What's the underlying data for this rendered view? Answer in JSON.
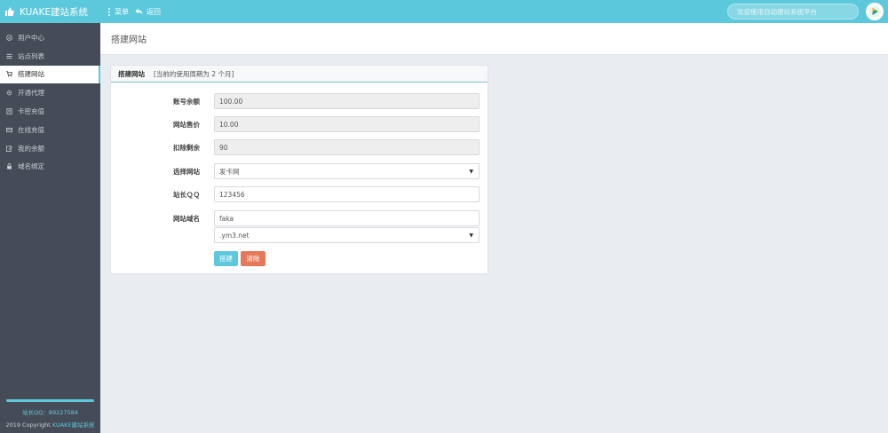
{
  "app": {
    "brand": "KUAKE建站系统",
    "menu_label": "菜单",
    "back_label": "返回",
    "search_placeholder": "欢迎使用自动建站系统平台"
  },
  "sidebar": {
    "items": [
      {
        "label": "用户中心",
        "icon": "circle-check-icon"
      },
      {
        "label": "站点列表",
        "icon": "list-icon"
      },
      {
        "label": "搭建网站",
        "icon": "cart-icon",
        "active": true
      },
      {
        "label": "开通代理",
        "icon": "gear-icon"
      },
      {
        "label": "卡密充值",
        "icon": "card-icon"
      },
      {
        "label": "在线充值",
        "icon": "wallet-icon"
      },
      {
        "label": "我的余额",
        "icon": "edit-icon"
      },
      {
        "label": "域名绑定",
        "icon": "lock-icon"
      }
    ],
    "footer_qq": "站长QQ：89227584",
    "footer_copy_prefix": "2019 Copyright ",
    "footer_copy_link": "KUAKE建站系统"
  },
  "page": {
    "title": "搭建网站"
  },
  "panel": {
    "title": "搭建网站",
    "note": "[当前的使用周期为 2 个月]"
  },
  "form": {
    "balance_label": "账号余额",
    "balance_value": "100.00",
    "price_label": "网站售价",
    "price_value": "10.00",
    "remain_label": "扣除剩余",
    "remain_value": "90",
    "site_label": "选择网站",
    "site_value": "发卡网",
    "qq_label": "站长ＱＱ",
    "qq_value": "123456",
    "domain_label": "网站域名",
    "domain_prefix_value": "faka",
    "domain_suffix_value": ".ym3.net",
    "submit_label": "搭建",
    "clear_label": "清除"
  },
  "colors": {
    "accent": "#5bc8dc",
    "sidebar_bg": "#464c57",
    "danger": "#e4795a",
    "page_bg": "#e9edf2"
  }
}
